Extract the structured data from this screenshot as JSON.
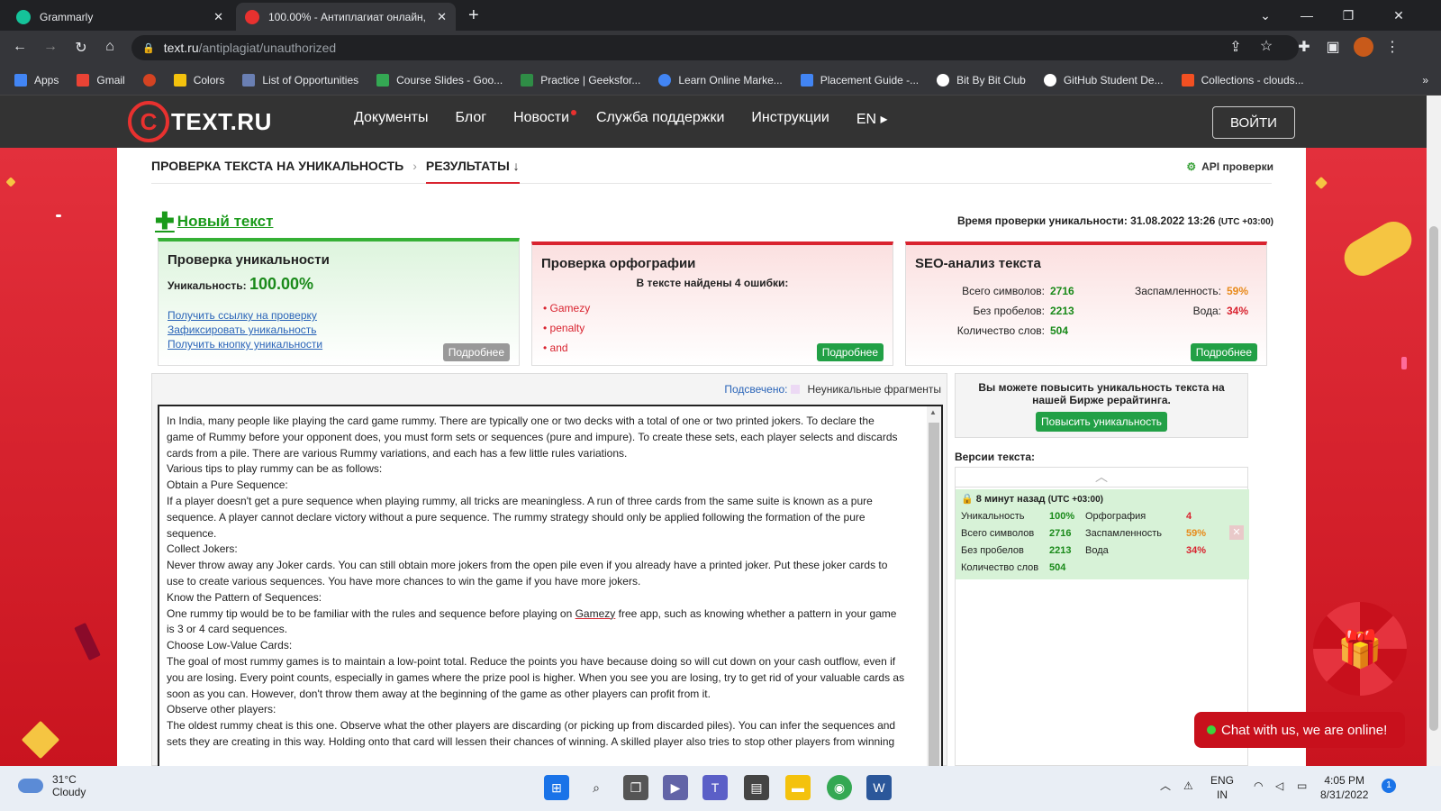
{
  "browser": {
    "tabs": [
      {
        "title": "Grammarly",
        "active": false,
        "favicon_color": "#15c39a"
      },
      {
        "title": "100.00% - Антиплагиат онлайн,",
        "active": true,
        "favicon_color": "#e8312f"
      }
    ],
    "new_tab": "+",
    "window_controls": [
      "⌄",
      "—",
      "❐",
      "✕"
    ],
    "url_domain": "text.ru",
    "url_path": "/antiplagiat/unauthorized",
    "bookmarks": [
      {
        "label": "Apps",
        "color": "#4285f4"
      },
      {
        "label": "Gmail",
        "color": "#ea4335"
      },
      {
        "label": "",
        "color": "#d44322"
      },
      {
        "label": "Colors",
        "color": "#f4c20d"
      },
      {
        "label": "List of Opportunities",
        "color": "#6a7fb3"
      },
      {
        "label": "Course Slides - Goo...",
        "color": "#34a853"
      },
      {
        "label": "Practice | Geeksfor...",
        "color": "#2f8d46"
      },
      {
        "label": "Learn Online Marke...",
        "color": "#4285f4"
      },
      {
        "label": "Placement Guide -...",
        "color": "#4285f4"
      },
      {
        "label": "Bit By Bit Club",
        "color": "#ffffff"
      },
      {
        "label": "GitHub Student De...",
        "color": "#ffffff"
      },
      {
        "label": "Collections - clouds...",
        "color": "#f25022"
      }
    ],
    "bookmarks_more": "»"
  },
  "site": {
    "logo_letter": "C",
    "logo_text": "TEXT.RU",
    "nav": [
      "Документы",
      "Блог",
      "Новости",
      "Служба поддержки",
      "Инструкции",
      "EN ▸"
    ],
    "login": "ВОЙТИ"
  },
  "content": {
    "crumb1": "ПРОВЕРКА ТЕКСТА НА УНИКАЛЬНОСТЬ",
    "crumb_sep": "›",
    "crumb2": "РЕЗУЛЬТАТЫ ↓",
    "api": "API проверки",
    "new_text": "Новый текст",
    "check_time_label": "Время проверки уникальности: 31.08.2022 13:26",
    "check_time_tz": "(UTC +03:00)",
    "uniq": {
      "title": "Проверка уникальности",
      "label": "Уникальность:",
      "value": "100.00%",
      "links": [
        "Получить ссылку на проверку",
        "Зафиксировать уникальность",
        "Получить кнопку уникальности"
      ],
      "more": "Подробнее"
    },
    "spell": {
      "title": "Проверка орфографии",
      "subtitle": "В тексте найдены 4 ошибки:",
      "errors": [
        "Gamezy",
        "penalty",
        "and"
      ],
      "more": "Подробнее"
    },
    "seo": {
      "title": "SEO-анализ текста",
      "rows": [
        {
          "l": "Всего символов:",
          "v": "2716",
          "l2": "Заспамленность:",
          "v2": "59%"
        },
        {
          "l": "Без пробелов:",
          "v": "2213",
          "l2": "Вода:",
          "v2": "34%"
        },
        {
          "l": "Количество слов:",
          "v": "504",
          "l2": "",
          "v2": ""
        }
      ],
      "more": "Подробнее"
    },
    "legend_label": "Подсвечено:",
    "legend_text": "Неуникальные фрагменты",
    "text_lines": [
      "In India, many people like playing the card game rummy. There are typically one or two decks with a total of one or two printed jokers. To declare the",
      "game of Rummy before your opponent does, you must form sets or sequences (pure and impure). To create these sets, each player selects and discards",
      "cards from a pile. There are various Rummy variations, and each has a few little rules variations.",
      "Various tips to play rummy can be as follows:",
      "Obtain a Pure Sequence:",
      "If a player doesn't get a pure sequence when playing rummy, all tricks are meaningless. A run of three cards from the same suite is known as a pure",
      "sequence. A player cannot declare victory without a pure sequence. The rummy strategy should only be applied following the formation of the pure",
      "sequence.",
      "Collect Jokers:",
      "Never throw away any Joker cards. You can still obtain more jokers from the open pile even if you already have a printed joker. Put these joker cards to",
      "use to create various sequences. You have more chances to win the game if you have more jokers.",
      "Know the Pattern of Sequences:",
      "One rummy tip would be to be familiar with the rules and sequence before playing on Gamezy free app, such as knowing whether a pattern in your game",
      "is 3 or 4 card sequences.",
      "Choose Low-Value Cards:",
      "The goal of most rummy games is to maintain a low-point total. Reduce the points you have because doing so will cut down on your cash outflow, even if",
      "you are losing. Every point counts, especially in games where the prize pool is higher. When you see you are losing, try to get rid of your valuable cards as",
      "soon as you can. However, don't throw them away at the beginning of the game as other players can profit from it.",
      "Observe other players:",
      "The oldest rummy cheat is this one. Observe what the other players are discarding (or picking up from discarded piles). You can infer the sequences and",
      "sets they are creating in this way. Holding onto that card will lessen their chances of winning. A skilled player also tries to stop other players from winning"
    ],
    "promo_text": "Вы можете повысить уникальность текста на нашей Бирже рерайтинга.",
    "promo_button": "Повысить уникальность",
    "versions_title": "Версии текста:",
    "version": {
      "time": "8 минут назад",
      "tz": "(UTC +03:00)",
      "rows": [
        {
          "a": "Уникальность",
          "av": "100%",
          "b": "Орфография",
          "bv": "4"
        },
        {
          "a": "Всего символов",
          "av": "2716",
          "b": "Заспамленность",
          "bv": "59%"
        },
        {
          "a": "Без пробелов",
          "av": "2213",
          "b": "Вода",
          "bv": "34%"
        },
        {
          "a": "Количество слов",
          "av": "504",
          "b": "",
          "bv": ""
        }
      ]
    },
    "chat": "Chat with us, we are online!"
  },
  "taskbar": {
    "temp": "31°C",
    "weather": "Cloudy",
    "lang1": "ENG",
    "lang2": "IN",
    "time": "4:05 PM",
    "date": "8/31/2022",
    "notif": "1"
  }
}
